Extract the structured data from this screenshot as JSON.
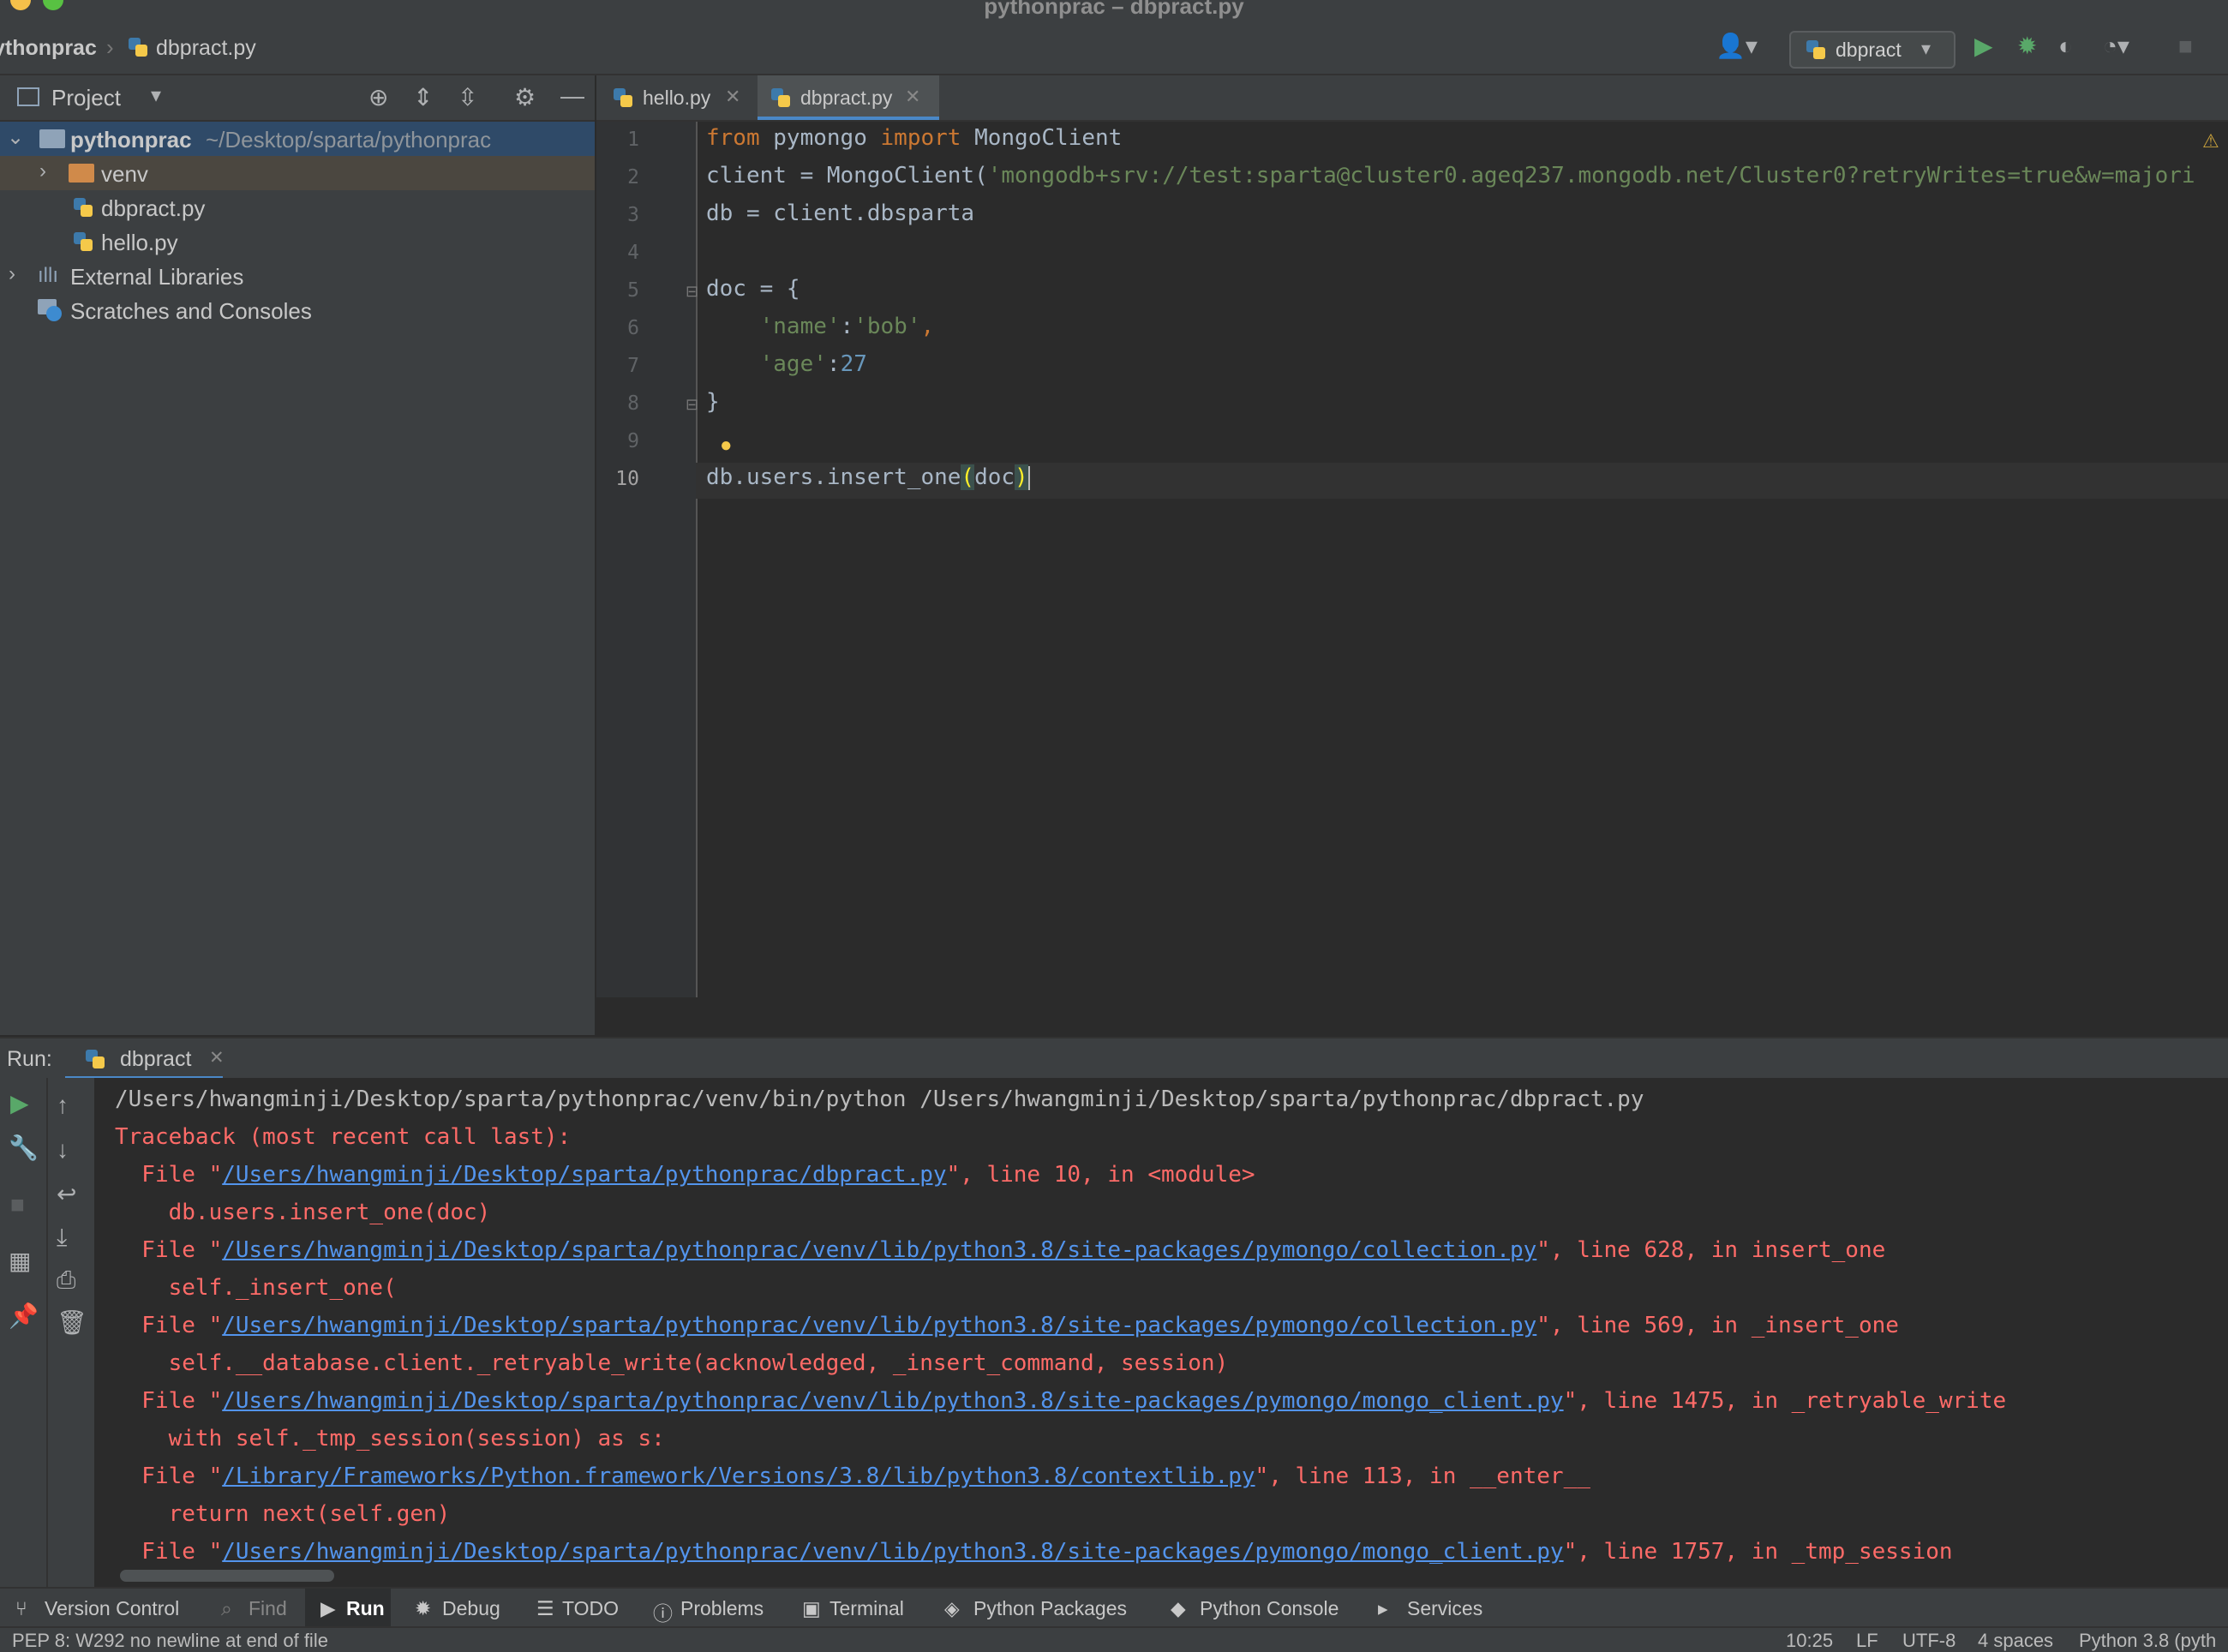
{
  "window": {
    "title": "pythonprac – dbpract.py"
  },
  "breadcrumb": {
    "project": "ythonprac",
    "file": "dbpract.py"
  },
  "toolbar": {
    "run_config": "dbpract"
  },
  "project_panel": {
    "title": "Project",
    "tree": [
      {
        "label": "pythonprac",
        "path": "~/Desktop/sparta/pythonprac"
      },
      {
        "label": "venv"
      },
      {
        "label": "dbpract.py"
      },
      {
        "label": "hello.py"
      },
      {
        "label": "External Libraries"
      },
      {
        "label": "Scratches and Consoles"
      }
    ]
  },
  "editor": {
    "tabs": [
      {
        "label": "hello.py"
      },
      {
        "label": "dbpract.py"
      }
    ],
    "line_numbers": [
      "1",
      "2",
      "3",
      "4",
      "5",
      "6",
      "7",
      "8",
      "9",
      "10"
    ],
    "code": {
      "l1": {
        "kw1": "from",
        "mod": " pymongo ",
        "kw2": "import",
        "rest": " MongoClient"
      },
      "l2": {
        "pre": "client = MongoClient(",
        "str": "'mongodb+srv://test:sparta@cluster0.ageq237.mongodb.net/Cluster0?retryWrites=true&w=majori"
      },
      "l3": "db = client.dbsparta",
      "l5": "doc = {",
      "l6": {
        "key": "'name'",
        "sep": ":",
        "val": "'bob'",
        "end": ","
      },
      "l7": {
        "key": "'age'",
        "sep": ":",
        "val": "27"
      },
      "l8": "}",
      "l10": {
        "pre": "db.users.insert_one",
        "open": "(",
        "arg": "doc",
        "close": ")"
      }
    }
  },
  "run_panel": {
    "label": "Run:",
    "tab": "dbpract",
    "output": [
      {
        "type": "plain",
        "text": "/Users/hwangminji/Desktop/sparta/pythonprac/venv/bin/python /Users/hwangminji/Desktop/sparta/pythonprac/dbpract.py"
      },
      {
        "type": "err",
        "text": "Traceback (most recent call last):"
      },
      {
        "type": "file",
        "pre": "  File \"",
        "link": "/Users/hwangminji/Desktop/sparta/pythonprac/dbpract.py",
        "post": "\", line 10, in <module>"
      },
      {
        "type": "err",
        "text": "    db.users.insert_one(doc)"
      },
      {
        "type": "file",
        "pre": "  File \"",
        "link": "/Users/hwangminji/Desktop/sparta/pythonprac/venv/lib/python3.8/site-packages/pymongo/collection.py",
        "post": "\", line 628, in insert_one"
      },
      {
        "type": "err",
        "text": "    self._insert_one("
      },
      {
        "type": "file",
        "pre": "  File \"",
        "link": "/Users/hwangminji/Desktop/sparta/pythonprac/venv/lib/python3.8/site-packages/pymongo/collection.py",
        "post": "\", line 569, in _insert_one"
      },
      {
        "type": "err",
        "text": "    self.__database.client._retryable_write(acknowledged, _insert_command, session)"
      },
      {
        "type": "file",
        "pre": "  File \"",
        "link": "/Users/hwangminji/Desktop/sparta/pythonprac/venv/lib/python3.8/site-packages/pymongo/mongo_client.py",
        "post": "\", line 1475, in _retryable_write"
      },
      {
        "type": "err",
        "text": "    with self._tmp_session(session) as s:"
      },
      {
        "type": "file",
        "pre": "  File \"",
        "link": "/Library/Frameworks/Python.framework/Versions/3.8/lib/python3.8/contextlib.py",
        "post": "\", line 113, in __enter__"
      },
      {
        "type": "err",
        "text": "    return next(self.gen)"
      },
      {
        "type": "file",
        "pre": "  File \"",
        "link": "/Users/hwangminji/Desktop/sparta/pythonprac/venv/lib/python3.8/site-packages/pymongo/mongo_client.py",
        "post": "\", line 1757, in _tmp_session"
      }
    ]
  },
  "bottom_tabs": {
    "version_control": "Version Control",
    "find": "Find",
    "run": "Run",
    "debug": "Debug",
    "todo": "TODO",
    "problems": "Problems",
    "terminal": "Terminal",
    "python_packages": "Python Packages",
    "python_console": "Python Console",
    "services": "Services"
  },
  "status": {
    "message": "PEP 8: W292 no newline at end of file",
    "position": "10:25",
    "line_ending": "LF",
    "encoding": "UTF-8",
    "indent": "4 spaces",
    "interpreter": "Python 3.8 (pyth"
  },
  "colors": {
    "background": "#2b2b2b",
    "panel": "#3c3f41",
    "keyword": "#cc7832",
    "string": "#6a8759",
    "number": "#6897bb",
    "error_text": "#ff6b68",
    "link": "#5394ec",
    "run_green": "#59a869"
  }
}
